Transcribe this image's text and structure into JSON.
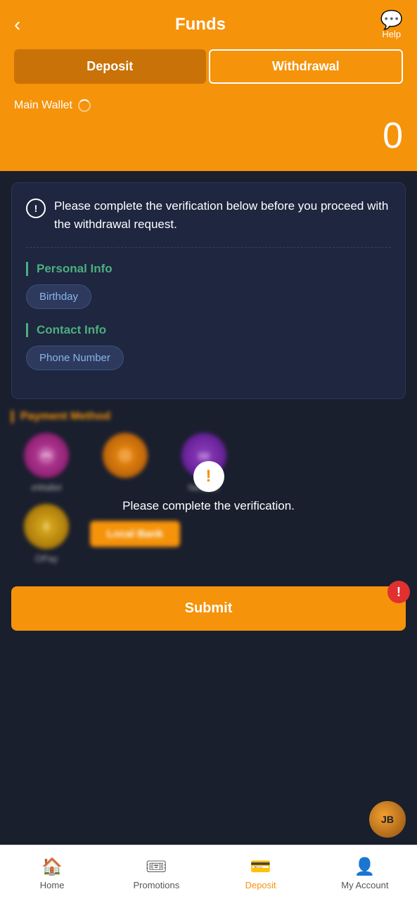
{
  "header": {
    "back_label": "‹",
    "title": "Funds",
    "help_label": "Help",
    "help_icon": "💬"
  },
  "tabs": {
    "deposit_label": "Deposit",
    "withdrawal_label": "Withdrawal",
    "active": "withdrawal"
  },
  "wallet": {
    "label": "Main Wallet",
    "amount": "0"
  },
  "verification_card": {
    "notice_text": "Please complete the verification below before you proceed with the withdrawal request.",
    "personal_info_title": "Personal Info",
    "birthday_label": "Birthday",
    "contact_info_title": "Contact Info",
    "phone_number_label": "Phone Number"
  },
  "payment": {
    "section_title": "Payment Method",
    "overlay_text": "Please complete the verification.",
    "methods": [
      {
        "label": "eWallet"
      },
      {
        "label": ""
      },
      {
        "label": "Neteller"
      }
    ],
    "local_bank_label": "Local Bank"
  },
  "submit": {
    "label": "Submit"
  },
  "floating_avatar": {
    "text": "JB"
  },
  "bottom_nav": {
    "items": [
      {
        "label": "Home",
        "icon": "🏠"
      },
      {
        "label": "Promotions",
        "icon": "🎟"
      },
      {
        "label": "Deposit",
        "icon": "💳"
      },
      {
        "label": "My Account",
        "icon": "👤"
      }
    ]
  }
}
